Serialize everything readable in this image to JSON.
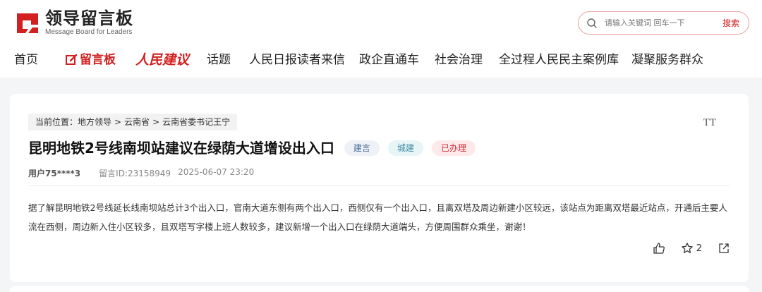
{
  "header": {
    "logo_title": "领导留言板",
    "logo_subtitle": "Message Board for Leaders",
    "search": {
      "placeholder": "请输入关键词 回车一下",
      "button": "搜索"
    }
  },
  "nav": {
    "items": [
      "首页",
      "留言板",
      "人民建议",
      "话题",
      "人民日报读者来信",
      "政企直通车",
      "社会治理",
      "全过程人民民主案例库",
      "凝聚服务群众"
    ]
  },
  "breadcrumb": {
    "label": "当前位置：",
    "items": [
      "地方领导",
      "云南省",
      "云南省委书记王宁"
    ],
    "separator": ">"
  },
  "message": {
    "title": "昆明地铁2号线南坝站建议在绿荫大道增设出入口",
    "tags": {
      "type": "建言",
      "domain": "城建",
      "status": "已办理"
    },
    "user": "用户75****3",
    "message_id": "留言ID:23158949",
    "datetime": "2025-06-07 23:20",
    "body": "据了解昆明地铁2号线延长线南坝站总计3个出入口，官南大道东侧有两个出入口，西侧仅有一个出入口，且离双塔及周边新建小区较远，该站点为距离双塔最近站点，开通后主要人流在西侧，周边新入住小区较多，且双塔写字楼上班人数较多，建议新增一个出入口在绿荫大道端头，方便周围群众乘坐，谢谢！",
    "actions": {
      "favorite_count": "2"
    },
    "font_toggle": "TT"
  },
  "colors": {
    "brand_red": "#d21f1f"
  }
}
